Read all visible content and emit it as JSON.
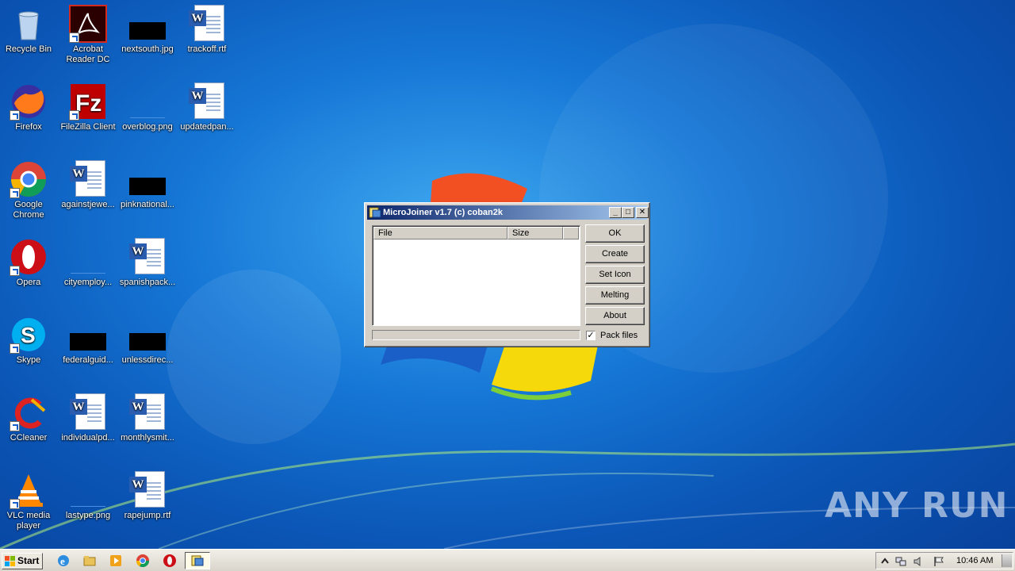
{
  "desktop": {
    "icons": [
      {
        "label": "Recycle Bin",
        "icon": "recycle-bin-icon"
      },
      {
        "label": "Acrobat Reader DC",
        "icon": "acrobat-reader-icon"
      },
      {
        "label": "nextsouth.jpg",
        "icon": "image-file-icon"
      },
      {
        "label": "trackoff.rtf",
        "icon": "word-document-icon"
      },
      {
        "label": "Firefox",
        "icon": "firefox-icon"
      },
      {
        "label": "FileZilla Client",
        "icon": "filezilla-icon"
      },
      {
        "label": "overblog.png",
        "icon": "image-file-icon"
      },
      {
        "label": "updatedpan...",
        "icon": "word-document-icon"
      },
      {
        "label": "Google Chrome",
        "icon": "chrome-icon"
      },
      {
        "label": "againstjewe...",
        "icon": "word-document-icon"
      },
      {
        "label": "pinknational...",
        "icon": "image-file-icon"
      },
      {
        "label": "Opera",
        "icon": "opera-icon"
      },
      {
        "label": "cityemploy...",
        "icon": "image-file-icon"
      },
      {
        "label": "spanishpack...",
        "icon": "word-document-icon"
      },
      {
        "label": "Skype",
        "icon": "skype-icon"
      },
      {
        "label": "federalguid...",
        "icon": "image-file-icon"
      },
      {
        "label": "unlessdirec...",
        "icon": "image-file-icon"
      },
      {
        "label": "CCleaner",
        "icon": "ccleaner-icon"
      },
      {
        "label": "individualpd...",
        "icon": "word-document-icon"
      },
      {
        "label": "monthlysmit...",
        "icon": "word-document-icon"
      },
      {
        "label": "VLC media player",
        "icon": "vlc-icon"
      },
      {
        "label": "lastype.png",
        "icon": "image-file-icon"
      },
      {
        "label": "rapejump.rtf",
        "icon": "word-document-icon"
      }
    ]
  },
  "window": {
    "title": "MicroJoiner v1.7 (c) coban2k",
    "columns": [
      "File",
      "Size"
    ],
    "buttons": {
      "ok": "OK",
      "create": "Create",
      "set_icon": "Set Icon",
      "melting": "Melting",
      "about": "About"
    },
    "pack_files": {
      "label": "Pack files",
      "checked": true
    }
  },
  "watermark": "ANY RUN",
  "taskbar": {
    "start_label": "Start",
    "clock": "10:46 AM"
  }
}
